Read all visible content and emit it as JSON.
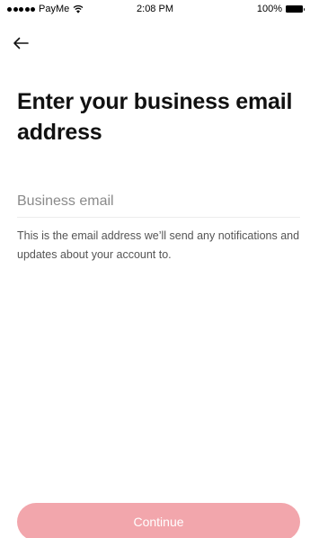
{
  "status_bar": {
    "carrier": "PayMe",
    "time": "2:08 PM",
    "battery": "100%"
  },
  "header": {
    "back_icon": "arrow-left-icon"
  },
  "main": {
    "title": "Enter your business email address",
    "email_placeholder": "Business email",
    "email_value": "",
    "helper": "This is the email address we’ll send any notifications and updates about your account to."
  },
  "footer": {
    "continue_label": "Continue"
  },
  "colors": {
    "accent_disabled": "#f2a6ac",
    "text_primary": "#111111",
    "text_secondary": "#555555"
  }
}
